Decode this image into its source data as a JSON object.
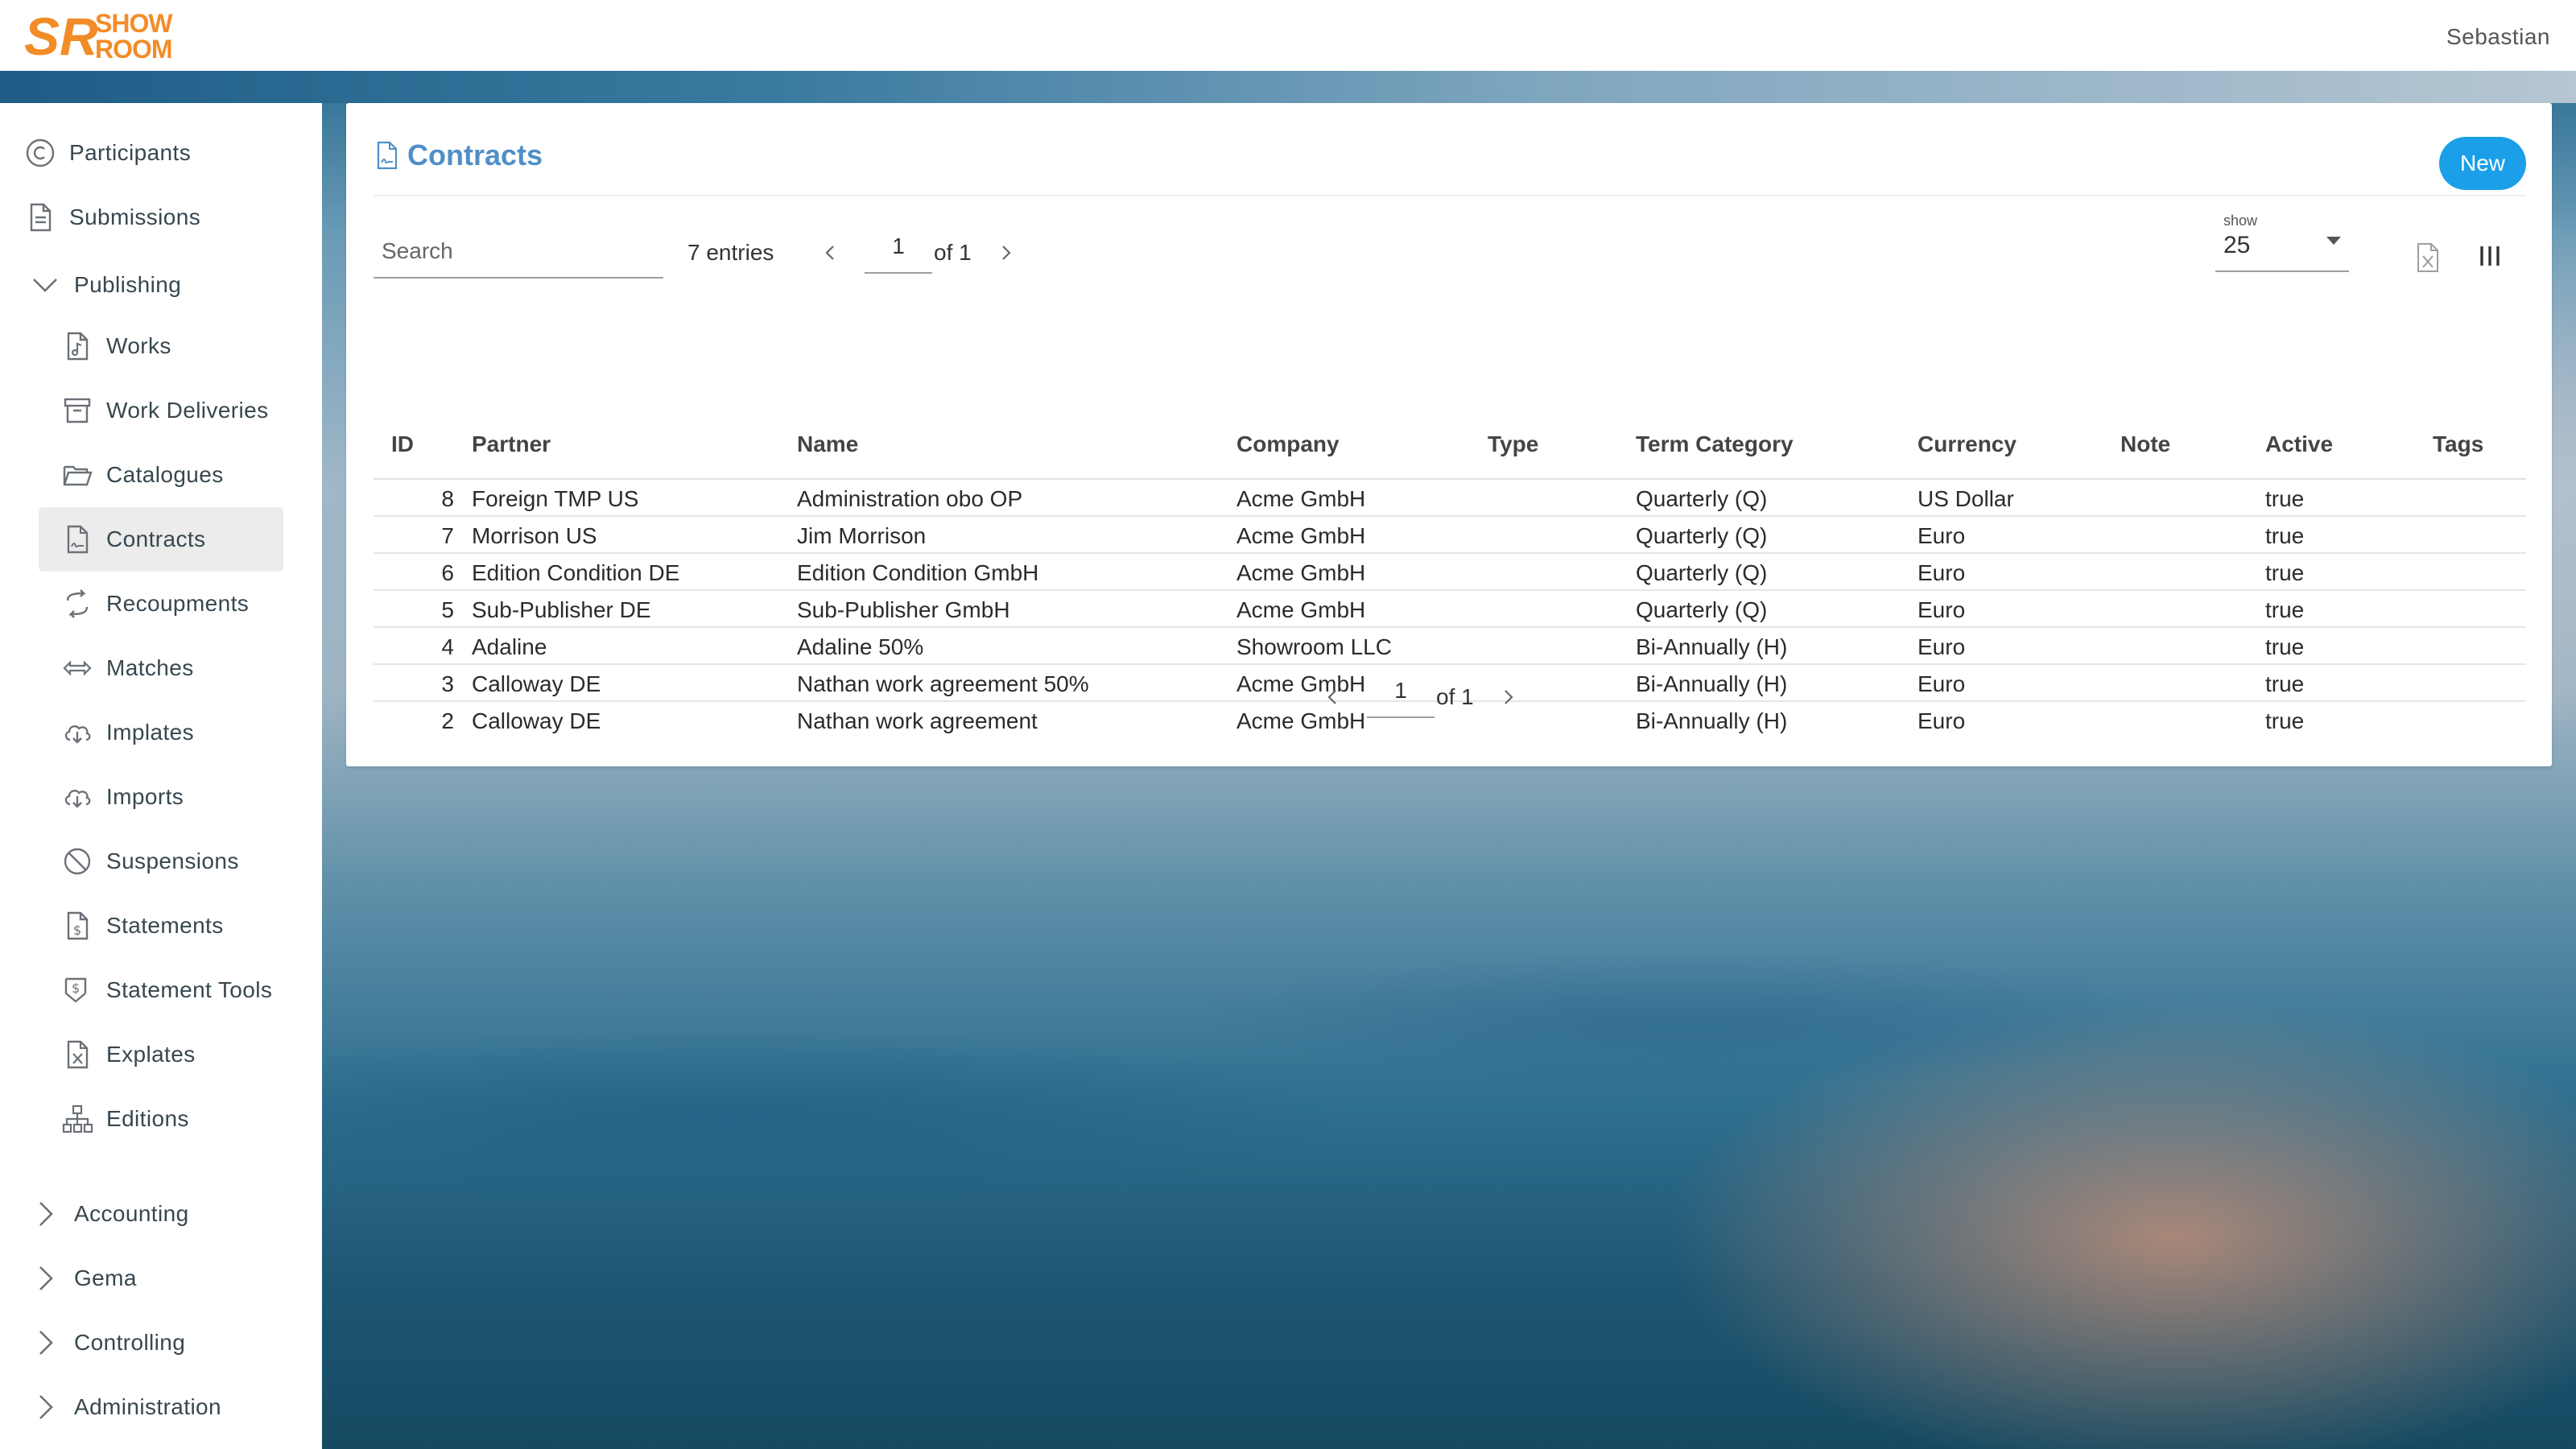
{
  "header": {
    "logo_text": "SR SHOW ROOM",
    "user_name": "Sebastian"
  },
  "sidebar": {
    "items": [
      {
        "label": "Participants",
        "icon": "copyright-circle-icon"
      },
      {
        "label": "Submissions",
        "icon": "document-icon"
      },
      {
        "label": "Publishing",
        "icon": "chevron-down-icon",
        "expanded": true
      },
      {
        "label": "Works",
        "icon": "music-file-icon"
      },
      {
        "label": "Work Deliveries",
        "icon": "archive-box-icon"
      },
      {
        "label": "Catalogues",
        "icon": "folder-open-icon"
      },
      {
        "label": "Contracts",
        "icon": "contract-file-icon",
        "active": true
      },
      {
        "label": "Recoupments",
        "icon": "swap-arrows-icon"
      },
      {
        "label": "Matches",
        "icon": "horizontal-arrows-icon"
      },
      {
        "label": "Implates",
        "icon": "cloud-download-icon"
      },
      {
        "label": "Imports",
        "icon": "cloud-download-icon"
      },
      {
        "label": "Suspensions",
        "icon": "block-icon"
      },
      {
        "label": "Statements",
        "icon": "dollar-file-icon"
      },
      {
        "label": "Statement Tools",
        "icon": "dollar-tools-icon"
      },
      {
        "label": "Explates",
        "icon": "excel-file-icon"
      },
      {
        "label": "Editions",
        "icon": "sitemap-icon"
      },
      {
        "label": "Accounting",
        "icon": "chevron-right-icon"
      },
      {
        "label": "Gema",
        "icon": "chevron-right-icon"
      },
      {
        "label": "Controlling",
        "icon": "chevron-right-icon"
      },
      {
        "label": "Administration",
        "icon": "chevron-right-icon"
      }
    ]
  },
  "card": {
    "title": "Contracts",
    "new_label": "New",
    "search_placeholder": "Search",
    "entries": "7 entries",
    "page": "1",
    "of_label": "of 1",
    "show_label": "show",
    "show_value": "25"
  },
  "table": {
    "headers": [
      "ID",
      "Partner",
      "Name",
      "Company",
      "Type",
      "Term Category",
      "Currency",
      "Note",
      "Active",
      "Tags"
    ],
    "rows": [
      [
        "8",
        "Foreign TMP US",
        "Administration obo OP",
        "Acme GmbH",
        "",
        "Quarterly (Q)",
        "US Dollar",
        "",
        "true",
        ""
      ],
      [
        "7",
        "Morrison US",
        "Jim Morrison",
        "Acme GmbH",
        "",
        "Quarterly (Q)",
        "Euro",
        "",
        "true",
        ""
      ],
      [
        "6",
        "Edition Condition DE",
        "Edition Condition GmbH",
        "Acme GmbH",
        "",
        "Quarterly (Q)",
        "Euro",
        "",
        "true",
        ""
      ],
      [
        "5",
        "Sub-Publisher DE",
        "Sub-Publisher GmbH",
        "Acme GmbH",
        "",
        "Quarterly (Q)",
        "Euro",
        "",
        "true",
        ""
      ],
      [
        "4",
        "Adaline",
        "Adaline 50%",
        "Showroom LLC",
        "",
        "Bi-Annually (H)",
        "Euro",
        "",
        "true",
        ""
      ],
      [
        "3",
        "Calloway DE",
        "Nathan work agreement 50%",
        "Acme GmbH",
        "",
        "Bi-Annually (H)",
        "Euro",
        "",
        "true",
        ""
      ],
      [
        "2",
        "Calloway DE",
        "Nathan work agreement",
        "Acme GmbH",
        "",
        "Bi-Annually (H)",
        "Euro",
        "",
        "true",
        ""
      ]
    ]
  },
  "colors": {
    "accent": "#1a9fe8",
    "title": "#4f8fc7",
    "logo": "#f28c28"
  }
}
